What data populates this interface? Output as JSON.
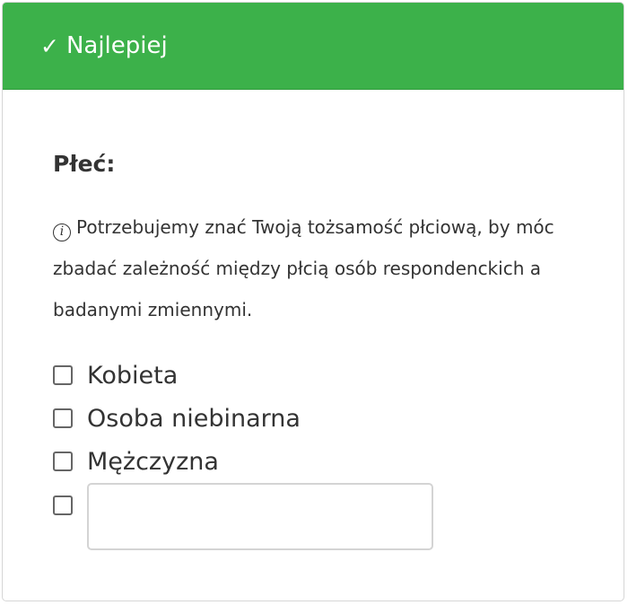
{
  "header": {
    "check_symbol": "✓",
    "title": "Najlepiej",
    "background_color": "#3cb14a"
  },
  "question": {
    "title": "Płeć:",
    "info_icon": "info-icon",
    "hint": "Potrzebujemy znać Twoją tożsamość płciową, by móc zbadać zależność między płcią osób respondenckich a badanymi zmiennymi.",
    "options": [
      {
        "label": "Kobieta",
        "checked": false
      },
      {
        "label": "Osoba niebinarna",
        "checked": false
      },
      {
        "label": "Mężczyzna",
        "checked": false
      }
    ],
    "other": {
      "checked": false,
      "value": "",
      "placeholder": ""
    }
  }
}
